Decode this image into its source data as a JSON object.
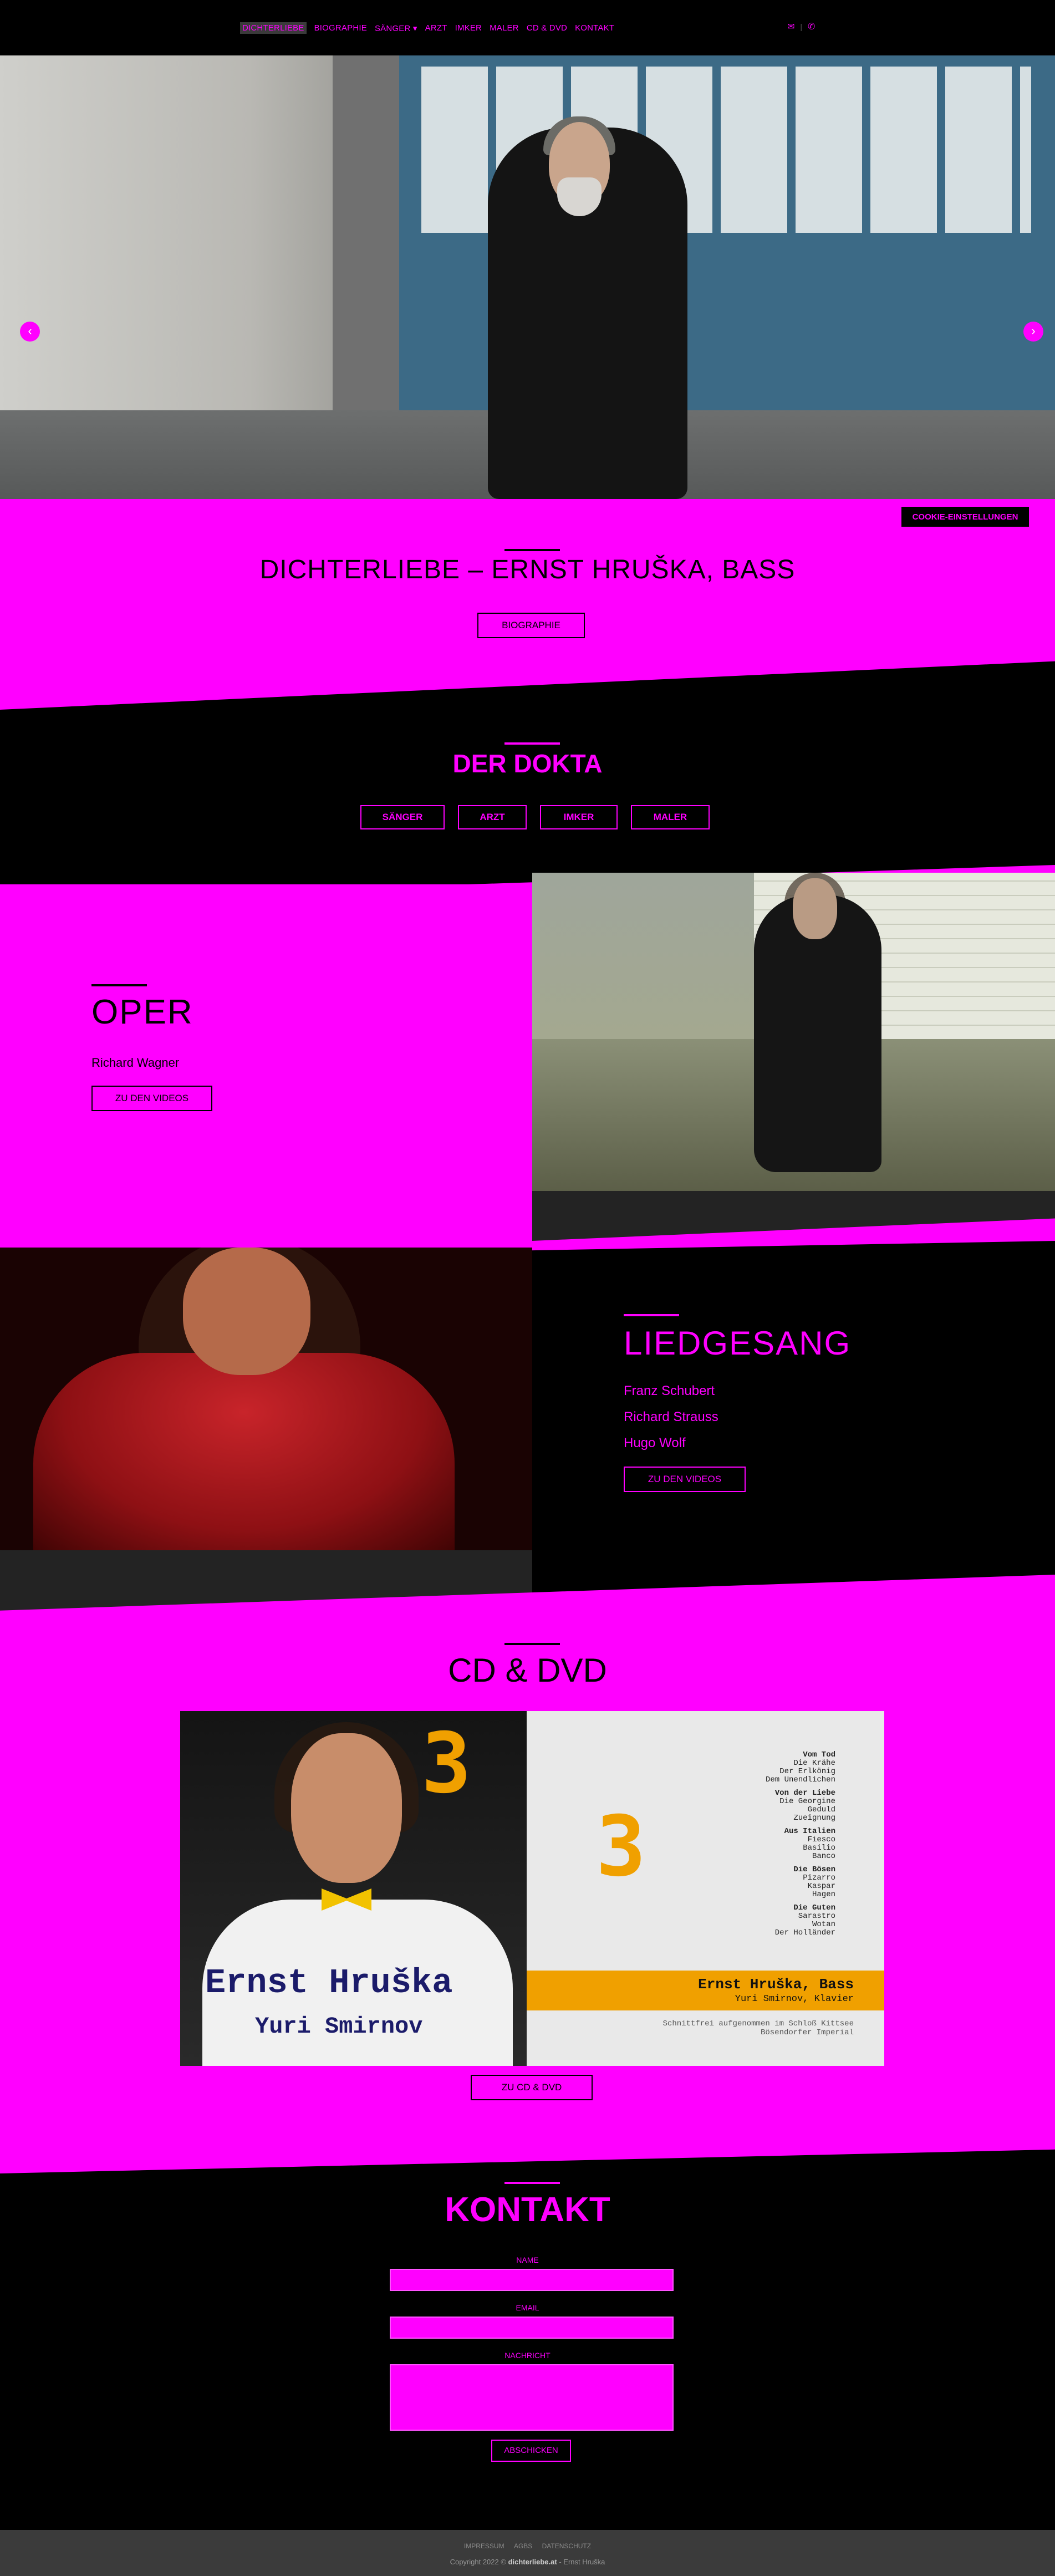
{
  "nav": {
    "items": [
      {
        "label": "Dichterliebe",
        "active": true
      },
      {
        "label": "Biographie"
      },
      {
        "label": "Sänger ▾"
      },
      {
        "label": "Arzt"
      },
      {
        "label": "Imker"
      },
      {
        "label": "Maler"
      },
      {
        "label": "CD & DVD"
      },
      {
        "label": "Kontakt"
      }
    ],
    "icons": [
      "mail-icon",
      "phone-icon"
    ]
  },
  "hero": {
    "prev_arrow": "‹",
    "next_arrow": "›",
    "slide_count": 3,
    "active_slide": 1
  },
  "cookie_button": "Cookie-Einstellungen",
  "intro": {
    "title": "DICHTERLIEBE – ERNST HRUŠKA, BASS",
    "button": "Biographie"
  },
  "dokta": {
    "title": "DER DOKTA",
    "buttons": [
      "Sänger",
      "Arzt",
      "Imker",
      "Maler"
    ]
  },
  "oper": {
    "title": "OPER",
    "subtitle": "Richard Wagner",
    "button": "Zu den Videos"
  },
  "lied": {
    "title": "LIEDGESANG",
    "composers": [
      "Franz Schubert",
      "Richard Strauss",
      "Hugo Wolf"
    ],
    "button": "Zu den Videos"
  },
  "cd": {
    "title": "CD & DVD",
    "cover": {
      "number": "3",
      "name": "Ernst Hruška",
      "pianist": "Yuri Smirnov",
      "track_groups": [
        {
          "heading": "Vom Tod",
          "items": [
            "Die Krähe",
            "Der Erlkönig",
            "Dem Unendlichen"
          ]
        },
        {
          "heading": "Von der Liebe",
          "items": [
            "Die Georgine",
            "Geduld",
            "Zueignung"
          ]
        },
        {
          "heading": "Aus Italien",
          "items": [
            "Fiesco",
            "Basilio",
            "Banco"
          ]
        },
        {
          "heading": "Die Bösen",
          "items": [
            "Pizarro",
            "Kaspar",
            "Hagen"
          ]
        },
        {
          "heading": "Die Guten",
          "items": [
            "Sarastro",
            "Wotan",
            "Der Holländer"
          ]
        }
      ],
      "band_line1": "Ernst Hruška, Bass",
      "band_line2": "Yuri Smirnov, Klavier",
      "recorded_line1": "Schnittfrei aufgenommen im Schloß Kittsee",
      "recorded_line2": "Bösendorfer Imperial"
    },
    "button": "Zu CD & DVD"
  },
  "kontakt": {
    "title": "KONTAKT",
    "name_label": "Name",
    "email_label": "Email",
    "message_label": "Nachricht",
    "send_button": "Abschicken"
  },
  "footer": {
    "links": [
      "Impressum",
      "AGBs",
      "Datenschutz"
    ],
    "copyright_prefix": "Copyright 2022 ©",
    "copyright_site": "dichterliebe.at",
    "copyright_suffix": "- Ernst Hruška"
  },
  "colors": {
    "accent": "#ff00ff",
    "background": "#000000",
    "cd_yellow": "#f0a000"
  }
}
